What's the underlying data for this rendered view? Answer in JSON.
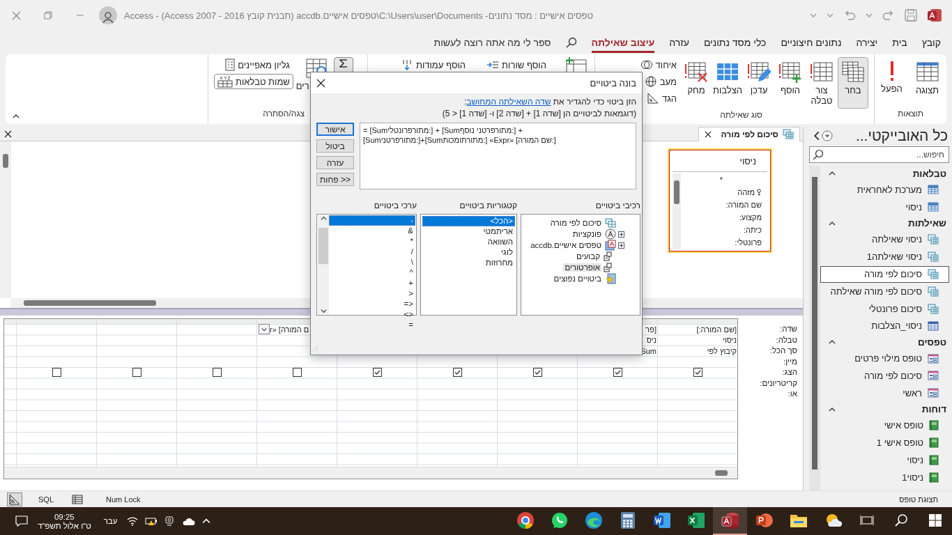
{
  "title_bar": {
    "title": "טפסים אישיים : מסד נתונים- C:\\Users\\user\\Documents\\טפסים אישיים.accdb (תבנית קובץ Access 2007 - 2016) - Access"
  },
  "menu_tabs": [
    {
      "label": "קובץ",
      "selected": false
    },
    {
      "label": "בית",
      "selected": false
    },
    {
      "label": "יצירה",
      "selected": false
    },
    {
      "label": "נתונים חיצוניים",
      "selected": false
    },
    {
      "label": "כלי מסד נתונים",
      "selected": false
    },
    {
      "label": "עזרה",
      "selected": false
    },
    {
      "label": "עיצוב שאילתה",
      "selected": true
    }
  ],
  "tell_me": "ספר לי מה אתה רוצה לעשות",
  "ribbon": {
    "results": {
      "label": "תוצאות",
      "buttons": [
        {
          "label": "תצוגה",
          "kind": "view",
          "selected": false
        },
        {
          "label": "הפעל",
          "kind": "run",
          "selected": false
        }
      ]
    },
    "query_type": {
      "label": "סוג שאילתה",
      "buttons": [
        {
          "label": "בחר",
          "kind": "select",
          "selected": true
        },
        {
          "label": "צור טבלה",
          "kind": "make-table",
          "selected": false
        },
        {
          "label": "הוסף",
          "kind": "append",
          "selected": false
        },
        {
          "label": "עדכן",
          "kind": "update",
          "selected": false
        },
        {
          "label": "הצלבות",
          "kind": "crosstab",
          "selected": false
        },
        {
          "label": "מחק",
          "kind": "delete",
          "selected": false
        }
      ],
      "small_buttons": [
        {
          "label": "איחוד",
          "kind": "union"
        },
        {
          "label": "מעב",
          "kind": "pass-through"
        },
        {
          "label": "הגד",
          "kind": "data-definition"
        }
      ]
    },
    "setup": {
      "small_buttons": [
        {
          "label": "הוסף שורות",
          "kind": "insert-rows"
        },
        {
          "label": "הוסף עמודות",
          "kind": "insert-columns"
        }
      ]
    },
    "show_hide": {
      "label": "צגה/הסתרה",
      "totals_on": true,
      "parameters_label": "רים",
      "property_sheet": {
        "label": "גליון מאפיינים",
        "on": false
      },
      "table_names": {
        "label": "שמות טבלאות",
        "on": true
      }
    }
  },
  "query_tab": {
    "label": "סיכום לפי מורה"
  },
  "field_list": {
    "title": "ניסוי",
    "fields": [
      {
        "name": "*",
        "key": false
      },
      {
        "name": "מזהה",
        "key": true
      },
      {
        "name": "שם המורה:",
        "key": false
      },
      {
        "name": "מקצוע:",
        "key": false
      },
      {
        "name": "כיתה:",
        "key": false
      },
      {
        "name": "פרונטלי:",
        "key": false
      }
    ]
  },
  "design_grid": {
    "row_labels": [
      "שדה:",
      "טבלה:",
      "סך הכל:",
      "מיין:",
      "הצג:",
      "קריטריונים:",
      "או:"
    ],
    "columns": [
      {
        "kind": "text",
        "field": "[שם המורה:]",
        "table": "ניסוי",
        "total": "קיבוץ לפי",
        "show": true
      },
      {
        "kind": "text",
        "field": "[פר",
        "table": "ניס",
        "total": "Sum",
        "show": true
      },
      {
        "kind": "text",
        "show": true
      },
      {
        "kind": "text",
        "show": true
      },
      {
        "kind": "text",
        "show": true
      },
      {
        "kind": "combo",
        "field": "ם המורה] «r",
        "show": false
      },
      {
        "kind": "text",
        "show": false
      },
      {
        "kind": "text",
        "show": false
      },
      {
        "kind": "text",
        "show": false
      }
    ]
  },
  "navigation": {
    "title": "כל האובייקטי...",
    "search_placeholder": "חיפוש...",
    "groups": [
      {
        "label": "טבלאות",
        "expanded": true,
        "items": [
          {
            "label": "מערכת לאחראית",
            "kind": "table",
            "selected": false
          },
          {
            "label": "ניסוי",
            "kind": "table",
            "selected": false
          }
        ]
      },
      {
        "label": "שאילתות",
        "expanded": true,
        "items": [
          {
            "label": "ניסוי שאילתה",
            "kind": "query",
            "selected": false
          },
          {
            "label": "ניסוי שאילתה1",
            "kind": "query",
            "selected": false
          },
          {
            "label": "סיכום לפי מורה",
            "kind": "query",
            "selected": true
          },
          {
            "label": "סיכום לפי מורה שאילתה",
            "kind": "query",
            "selected": false
          },
          {
            "label": "סיכום פרונטלי",
            "kind": "query",
            "selected": false
          },
          {
            "label": "ניסוי_הצלבות",
            "kind": "crosstab",
            "selected": false
          }
        ]
      },
      {
        "label": "טפסים",
        "expanded": true,
        "items": [
          {
            "label": "טופס מילוי פרטים",
            "kind": "form",
            "selected": false
          },
          {
            "label": "סיכום לפי מורה",
            "kind": "form",
            "selected": false
          },
          {
            "label": "ראשי",
            "kind": "form",
            "selected": false
          }
        ]
      },
      {
        "label": "דוחות",
        "expanded": true,
        "items": [
          {
            "label": "טופס אישי",
            "kind": "report",
            "selected": false
          },
          {
            "label": "טופס אישי 1",
            "kind": "report",
            "selected": false
          },
          {
            "label": "ניסוי",
            "kind": "report",
            "selected": false
          },
          {
            "label": "ניסוי1",
            "kind": "report",
            "selected": false
          }
        ]
      }
    ]
  },
  "dialog": {
    "title": "בונה ביטויים",
    "instruction": "הזן ביטוי כדי להגדיר את ",
    "instruction_link": "שדה השאילתה המחושב",
    "instruction_end": ":",
    "example": "(דוגמאות לביטויים הן [שדה 1] + [שדה 2] ו- [שדה 1] < 5)",
    "expression": [
      "= [Sumמתורפרונטלי:] + [Sumמתורפרטני נוסף:] +",
      "[Sumמתורפרטני:]+[Sumמתורתומכות:] «Expr» [שם המורה:]"
    ],
    "buttons": [
      {
        "label": "אישור",
        "default": true
      },
      {
        "label": "ביטול",
        "default": false
      },
      {
        "label": "עזרה",
        "default": false
      },
      {
        "label": "<< פחות",
        "default": false
      }
    ],
    "elements_label": "רכיבי ביטויים",
    "categories_label": "קטגוריות ביטויים",
    "values_label": "ערכי ביטויים",
    "elements": [
      {
        "label": "סיכום לפי מורה",
        "kind": "query",
        "expandable": false,
        "selected": false
      },
      {
        "label": "פונקציות",
        "kind": "functions",
        "expandable": true,
        "selected": false
      },
      {
        "label": "טפסים אישיים.accdb",
        "kind": "database",
        "expandable": true,
        "selected": false
      },
      {
        "label": "קבועים",
        "kind": "constants",
        "expandable": false,
        "selected": false
      },
      {
        "label": "אופרטורים",
        "kind": "operators",
        "expandable": false,
        "selected": true
      },
      {
        "label": "ביטויים נפוצים",
        "kind": "common",
        "expandable": false,
        "selected": false
      }
    ],
    "categories": [
      {
        "label": "<הכל>",
        "selected": true
      },
      {
        "label": "אריתמטי",
        "selected": false
      },
      {
        "label": "השוואה",
        "selected": false
      },
      {
        "label": "לוגי",
        "selected": false
      },
      {
        "label": "מחרוזות",
        "selected": false
      }
    ],
    "values": [
      {
        "label": "-",
        "selected": true
      },
      {
        "label": "&",
        "selected": false
      },
      {
        "label": "*",
        "selected": false
      },
      {
        "label": "/",
        "selected": false
      },
      {
        "label": "\\",
        "selected": false
      },
      {
        "label": "^",
        "selected": false
      },
      {
        "label": "+",
        "selected": false
      },
      {
        "label": ">",
        "selected": false
      },
      {
        "label": "=>",
        "selected": false
      },
      {
        "label": "<>",
        "selected": false
      },
      {
        "label": "=",
        "selected": false
      }
    ]
  },
  "status_bar": {
    "views": [
      {
        "kind": "design",
        "selected": true
      },
      {
        "kind": "sql",
        "label": "SQL",
        "selected": false
      },
      {
        "kind": "datasheet",
        "selected": false
      }
    ],
    "num_lock": "Num Lock",
    "view_name": "תצוגת טופס"
  },
  "taskbar": {
    "time": "09:25",
    "date": "ט\"ו אלול תשפ\"ד",
    "language": "עבר",
    "apps": [
      {
        "kind": "chrome",
        "active": false
      },
      {
        "kind": "whatsapp",
        "active": false
      },
      {
        "kind": "edge",
        "active": false
      },
      {
        "kind": "calculator",
        "active": false
      },
      {
        "kind": "word",
        "active": false
      },
      {
        "kind": "excel",
        "active": false
      },
      {
        "kind": "access",
        "active": true
      },
      {
        "kind": "powerpoint",
        "active": false
      },
      {
        "kind": "explorer",
        "active": false
      },
      {
        "kind": "weather",
        "active": false
      }
    ]
  }
}
